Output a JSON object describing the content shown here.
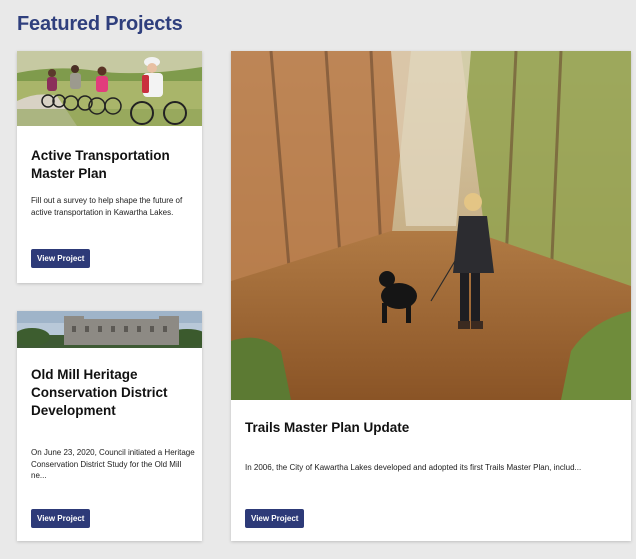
{
  "section": {
    "title": "Featured Projects"
  },
  "cards": [
    {
      "title": "Active Transportation Master Plan",
      "description": "Fill out a survey to help shape the future of active transportation in Kawartha Lakes.",
      "button": "View Project",
      "image": "cyclists-on-trail"
    },
    {
      "title": "Old Mill Heritage Conservation District Development",
      "description": "On June 23, 2020, Council initiated a Heritage Conservation District Study for the Old Mill ne...",
      "button": "View Project",
      "image": "old-stone-mill"
    },
    {
      "title": "Trails Master Plan Update",
      "description": "In 2006, the City of Kawartha Lakes developed and adopted its first Trails Master Plan, includ...",
      "button": "View Project",
      "image": "woman-walking-dog-on-autumn-trail"
    }
  ],
  "colors": {
    "accent": "#2f3f7d",
    "button": "#2d3a78",
    "background": "#e9e9e9"
  }
}
